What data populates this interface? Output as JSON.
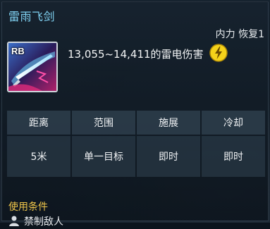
{
  "skill": {
    "name": "雷雨飞剑",
    "cost": "内力 恢复1",
    "keybind": "RB",
    "damage": "13,055~14,411的雷电伤害",
    "element_icon": "lightning-icon"
  },
  "stats": {
    "headers": [
      "距离",
      "范围",
      "施展",
      "冷却"
    ],
    "values": [
      "5米",
      "单一目标",
      "即时",
      "即时"
    ]
  },
  "conditions": {
    "label": "使用条件",
    "item": "禁制敌人"
  },
  "colors": {
    "title": "#7fd0f0",
    "condition_label": "#f0c64a",
    "lightning": "#f5d21a"
  }
}
